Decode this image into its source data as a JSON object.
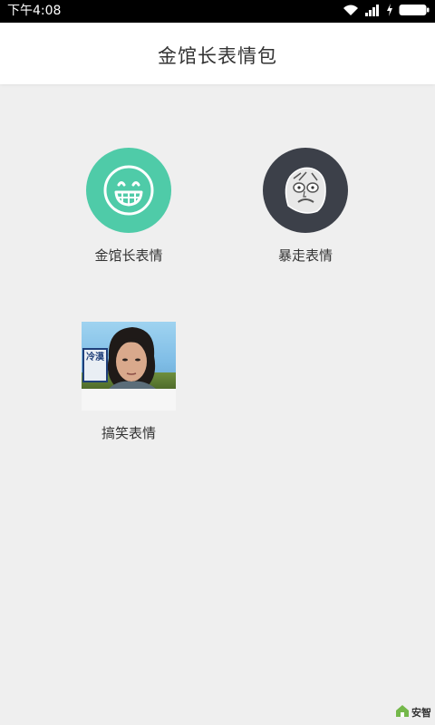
{
  "status_bar": {
    "time": "下午4:08"
  },
  "header": {
    "title": "金馆长表情包"
  },
  "items": [
    {
      "label": "金馆长表情",
      "icon": "grin-face-icon",
      "color": "#4fcba8"
    },
    {
      "label": "暴走表情",
      "icon": "rage-face-icon",
      "color": "#3c4049"
    },
    {
      "label": "搞笑表情",
      "icon": "photo-thumbnail"
    }
  ],
  "photo_caption": "冷漠",
  "watermark": {
    "text": "安智"
  }
}
